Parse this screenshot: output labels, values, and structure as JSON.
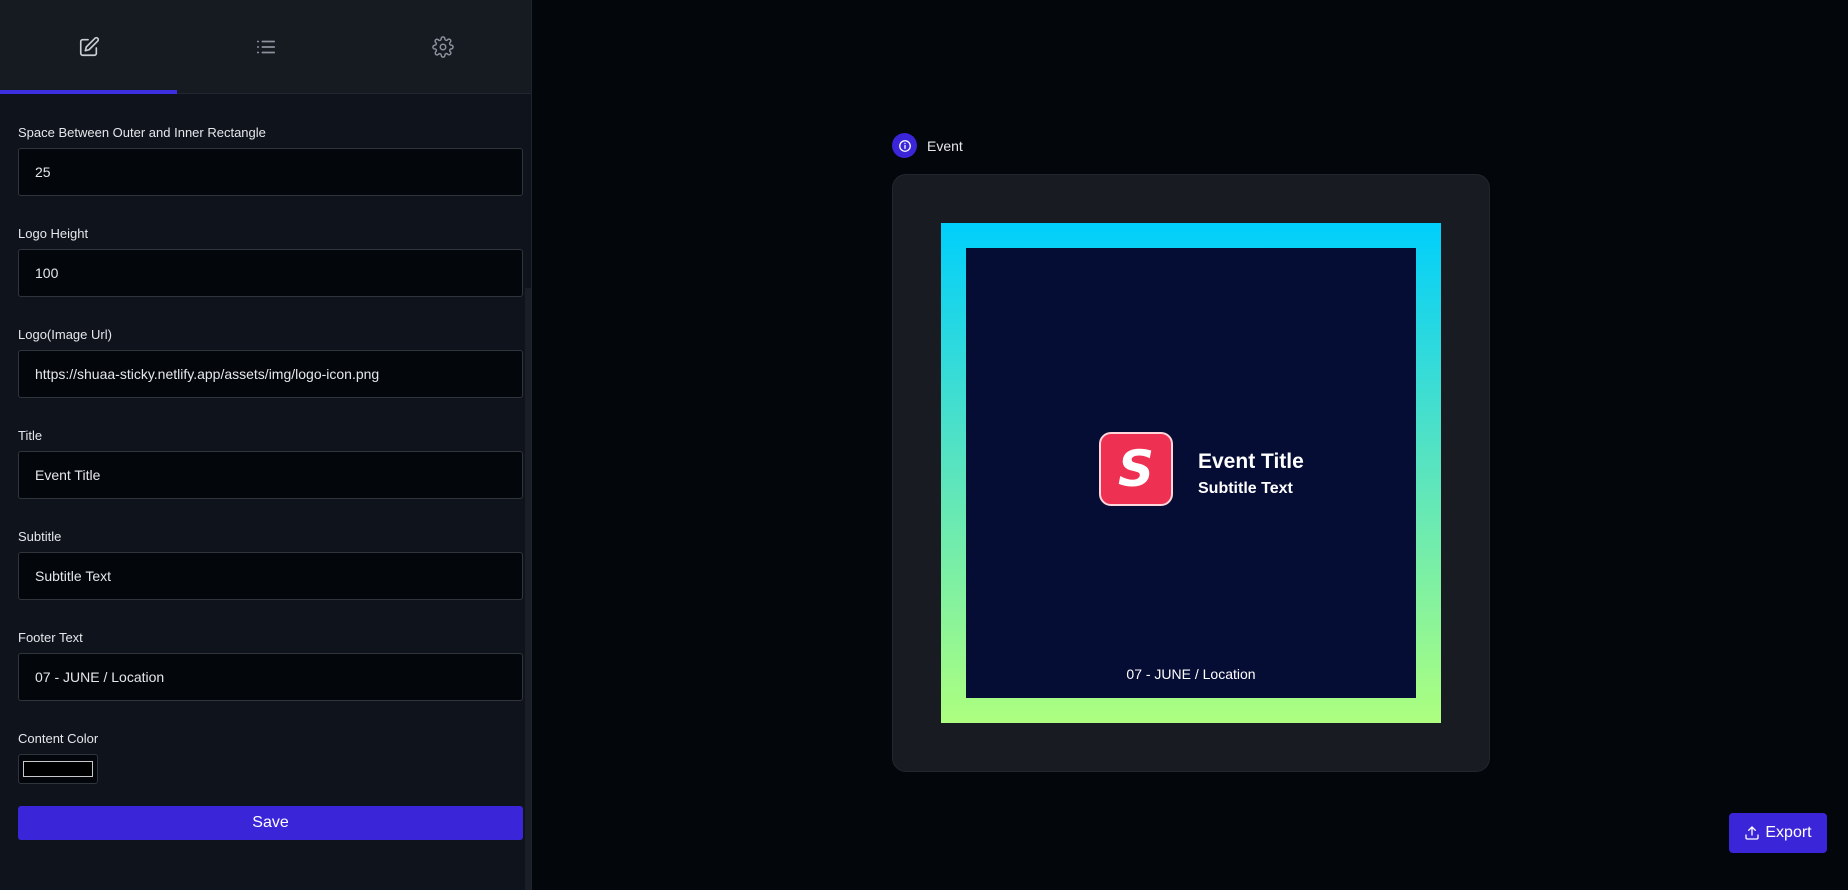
{
  "sidebar": {
    "tabs": [
      {
        "icon": "edit-icon",
        "active": true
      },
      {
        "icon": "list-icon",
        "active": false
      },
      {
        "icon": "gear-icon",
        "active": false
      }
    ],
    "fields": {
      "spacing": {
        "label": "Space Between Outer and Inner Rectangle",
        "value": "25"
      },
      "logo_height": {
        "label": "Logo Height",
        "value": "100"
      },
      "logo_url": {
        "label": "Logo(Image Url)",
        "value": "https://shuaa-sticky.netlify.app/assets/img/logo-icon.png"
      },
      "title": {
        "label": "Title",
        "value": "Event Title"
      },
      "subtitle": {
        "label": "Subtitle",
        "value": "Subtitle Text"
      },
      "footer": {
        "label": "Footer Text",
        "value": "07 - JUNE / Location"
      },
      "content_color": {
        "label": "Content Color",
        "value": "#000000"
      }
    },
    "save_label": "Save"
  },
  "preview": {
    "badge_label": "Event",
    "logo_letter": "S",
    "title": "Event Title",
    "subtitle": "Subtitle Text",
    "footer": "07 - JUNE / Location",
    "colors": {
      "gradient_top": "#00cffc",
      "gradient_bottom": "#adff7f",
      "inner_bg": "#060d35",
      "logo_bg": "#ee3152"
    }
  },
  "export_label": "Export",
  "colors": {
    "accent": "#3b25d9",
    "sidebar_bg": "#0f131b",
    "page_bg": "#03060b"
  }
}
